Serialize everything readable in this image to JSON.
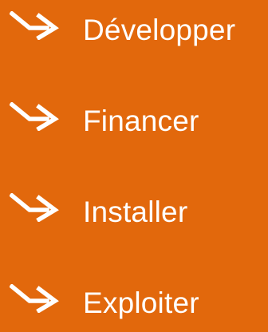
{
  "colors": {
    "background": "#E2680C",
    "icon": "#ffffff",
    "text": "#ffffff"
  },
  "items": [
    {
      "label": "Développer",
      "icon": "arrow-right-icon"
    },
    {
      "label": "Financer",
      "icon": "arrow-right-icon"
    },
    {
      "label": "Installer",
      "icon": "arrow-right-icon"
    },
    {
      "label": "Exploiter",
      "icon": "arrow-right-icon"
    }
  ]
}
